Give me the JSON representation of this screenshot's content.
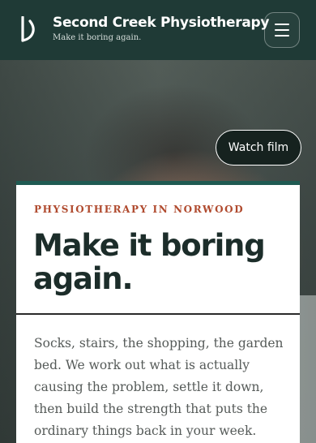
{
  "header": {
    "brand_name": "Second Creek Physiotherapy",
    "brand_tagline": "Make it boring again.",
    "logo_icon": "creek-d-logo-icon",
    "menu_icon": "hamburger-menu-icon"
  },
  "hero": {
    "watch_label": "Watch film"
  },
  "card": {
    "eyebrow": "PHYSIOTHERAPY IN NORWOOD",
    "headline": "Make it boring again.",
    "body": "Socks, stairs, the shopping, the garden bed. We work out what is actually causing the problem, settle it down, then build the strength that puts the ordinary things back in your week."
  },
  "colors": {
    "header_bg": "#1f3a36",
    "accent_bar": "#1f5a52",
    "eyebrow": "#b04a2e",
    "headline": "#1c2d2a"
  }
}
